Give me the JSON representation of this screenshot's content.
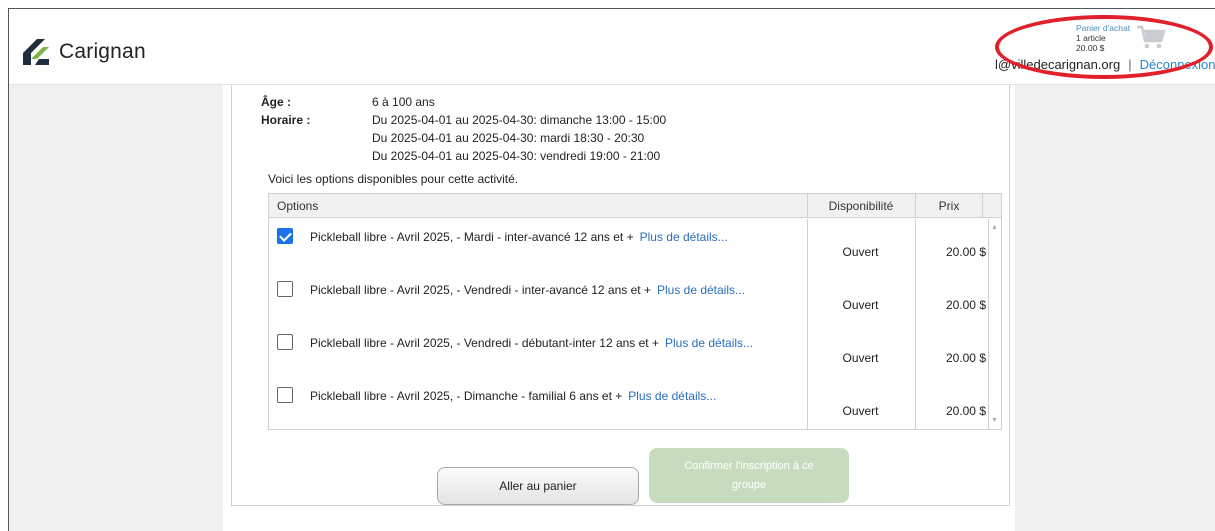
{
  "header": {
    "logo_text": "Carignan",
    "cart": {
      "title": "Panier d'achat",
      "count": "1 article",
      "amount": "20.00 $"
    },
    "user_email": "l@villedecarignan.org",
    "separator": "|",
    "logout": "Déconnexion"
  },
  "info": {
    "age_label": "Âge :",
    "age_value": "6 à 100 ans",
    "schedule_label": "Horaire :",
    "schedule": [
      "Du 2025-04-01 au 2025-04-30: dimanche 13:00 - 15:00",
      "Du 2025-04-01 au 2025-04-30: mardi 18:30 - 20:30",
      "Du 2025-04-01 au 2025-04-30: vendredi 19:00 - 21:00"
    ]
  },
  "options_intro": "Voici les options disponibles pour cette activité.",
  "table": {
    "headers": {
      "options": "Options",
      "disponibilite": "Disponibilité",
      "prix": "Prix"
    },
    "rows": [
      {
        "label": "Pickleball libre - Avril 2025, - Mardi - inter-avancé 12 ans et +",
        "more": "Plus de détails...",
        "dispo": "Ouvert",
        "prix": "20.00 $",
        "checked": true
      },
      {
        "label": "Pickleball libre - Avril 2025, - Vendredi - inter-avancé 12 ans et +",
        "more": "Plus de détails...",
        "dispo": "Ouvert",
        "prix": "20.00 $",
        "checked": false
      },
      {
        "label": "Pickleball libre - Avril 2025, - Vendredi - débutant-inter 12 ans et +",
        "more": "Plus de détails...",
        "dispo": "Ouvert",
        "prix": "20.00 $",
        "checked": false
      },
      {
        "label": "Pickleball libre - Avril 2025, - Dimanche - familial 6 ans et +",
        "more": "Plus de détails...",
        "dispo": "Ouvert",
        "prix": "20.00 $",
        "checked": false
      }
    ]
  },
  "buttons": {
    "cart": "Aller au panier",
    "confirm": "Confirmer l'inscription à ce groupe"
  },
  "colors": {
    "accent": "#2a6ebb",
    "annotation": "#e2202c",
    "confirm_disabled": "#c7dcbf"
  }
}
